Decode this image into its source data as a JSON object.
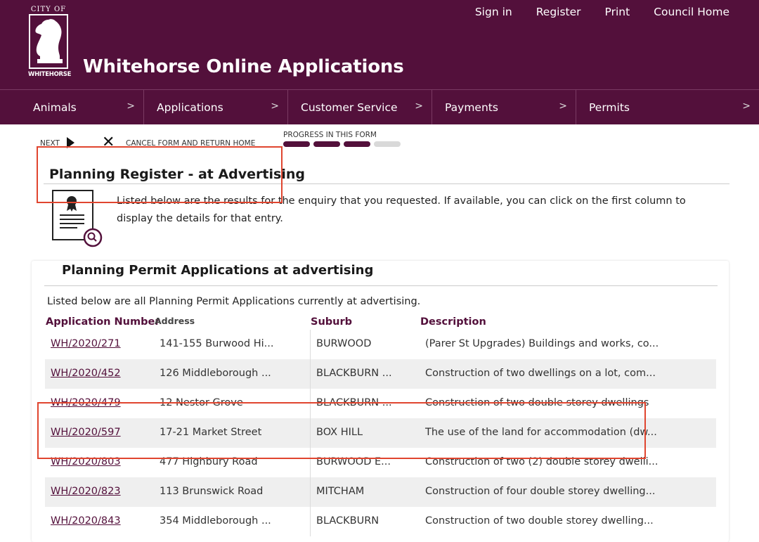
{
  "header": {
    "logo_city": "CITY OF",
    "logo_name": "WHITEHORSE",
    "title": "Whitehorse Online Applications",
    "links": [
      "Sign in",
      "Register",
      "Print",
      "Council Home"
    ]
  },
  "nav": {
    "items": [
      {
        "label": "Animals"
      },
      {
        "label": "Applications"
      },
      {
        "label": "Customer Service"
      },
      {
        "label": "Payments"
      },
      {
        "label": "Permits"
      }
    ],
    "arrow": ">"
  },
  "toolbar": {
    "next_label": "NEXT",
    "cancel_label": "CANCEL FORM AND RETURN HOME",
    "progress_label": "PROGRESS IN THIS FORM",
    "progress": {
      "completed": 3,
      "total": 4
    }
  },
  "page": {
    "heading": "Planning Register - at Advertising",
    "intro": "Listed below are the results for the enquiry that you requested. If available, you can click on the first column to display the details for that entry."
  },
  "card": {
    "title": "Planning Permit Applications at advertising",
    "intro": "Listed below are all Planning Permit Applications currently at advertising.",
    "columns": [
      "Application Number",
      "Address",
      "Suburb",
      "Description"
    ],
    "rows": [
      {
        "app": "WH/2020/271",
        "address": "141-155 Burwood Hi...",
        "suburb": "BURWOOD",
        "description": "(Parer St Upgrades) Buildings and works, co..."
      },
      {
        "app": "WH/2020/452",
        "address": "126 Middleborough ...",
        "suburb": "BLACKBURN ...",
        "description": "Construction of two dwellings on a lot, com..."
      },
      {
        "app": "WH/2020/479",
        "address": "12 Nestor Grove",
        "suburb": "BLACKBURN ...",
        "description": "Construction of two double storey dwellings"
      },
      {
        "app": "WH/2020/597",
        "address": "17-21 Market Street",
        "suburb": "BOX HILL",
        "description": "The use of the land for accommodation (dw..."
      },
      {
        "app": "WH/2020/803",
        "address": "477 Highbury Road",
        "suburb": "BURWOOD E...",
        "description": "Construction of two (2) double storey dwelli..."
      },
      {
        "app": "WH/2020/823",
        "address": "113 Brunswick Road",
        "suburb": "MITCHAM",
        "description": "Construction of four double storey dwelling..."
      },
      {
        "app": "WH/2020/843",
        "address": "354 Middleborough ...",
        "suburb": "BLACKBURN",
        "description": "Construction of two double storey dwelling..."
      }
    ]
  },
  "colors": {
    "brand": "#53103b",
    "highlight": "#e0452f"
  }
}
